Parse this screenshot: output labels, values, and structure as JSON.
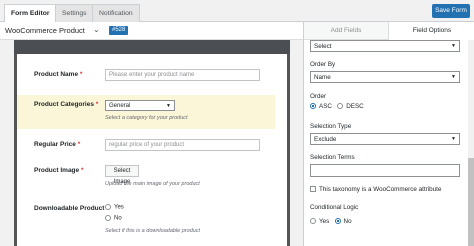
{
  "tabs": [
    {
      "label": "Form Editor"
    },
    {
      "label": "Settings"
    },
    {
      "label": "Notification"
    }
  ],
  "save_label": "Save Form",
  "form": {
    "title": "WooCommerce Product",
    "id_badge": "#528"
  },
  "fields": {
    "product_name": {
      "label": "Product Name",
      "placeholder": "Please enter your product name"
    },
    "product_categories": {
      "label": "Product Categories",
      "value": "General",
      "help": "Select a category for your product"
    },
    "regular_price": {
      "label": "Regular Price",
      "placeholder": "regular price of your product"
    },
    "product_image": {
      "label": "Product Image",
      "button": "Select Image",
      "help": "Upload the main image of your product"
    },
    "downloadable": {
      "label": "Downloadable Product",
      "options": [
        "Yes",
        "No"
      ],
      "help": "Select if this is a downloadable product"
    }
  },
  "sidebar": {
    "tabs": [
      "Add Fields",
      "Field Options"
    ],
    "top_select": "Select",
    "order_by": {
      "label": "Order By",
      "value": "Name"
    },
    "order": {
      "label": "Order",
      "options": [
        "ASC",
        "DESC"
      ],
      "selected": "ASC"
    },
    "selection_type": {
      "label": "Selection Type",
      "value": "Exclude"
    },
    "selection_terms": {
      "label": "Selection Terms"
    },
    "attribute_checkbox": "This taxonomy is a WooCommerce attribute",
    "conditional_logic": {
      "label": "Conditional Logic",
      "options": [
        "Yes",
        "No"
      ],
      "selected": "No"
    }
  },
  "required_mark": "*"
}
